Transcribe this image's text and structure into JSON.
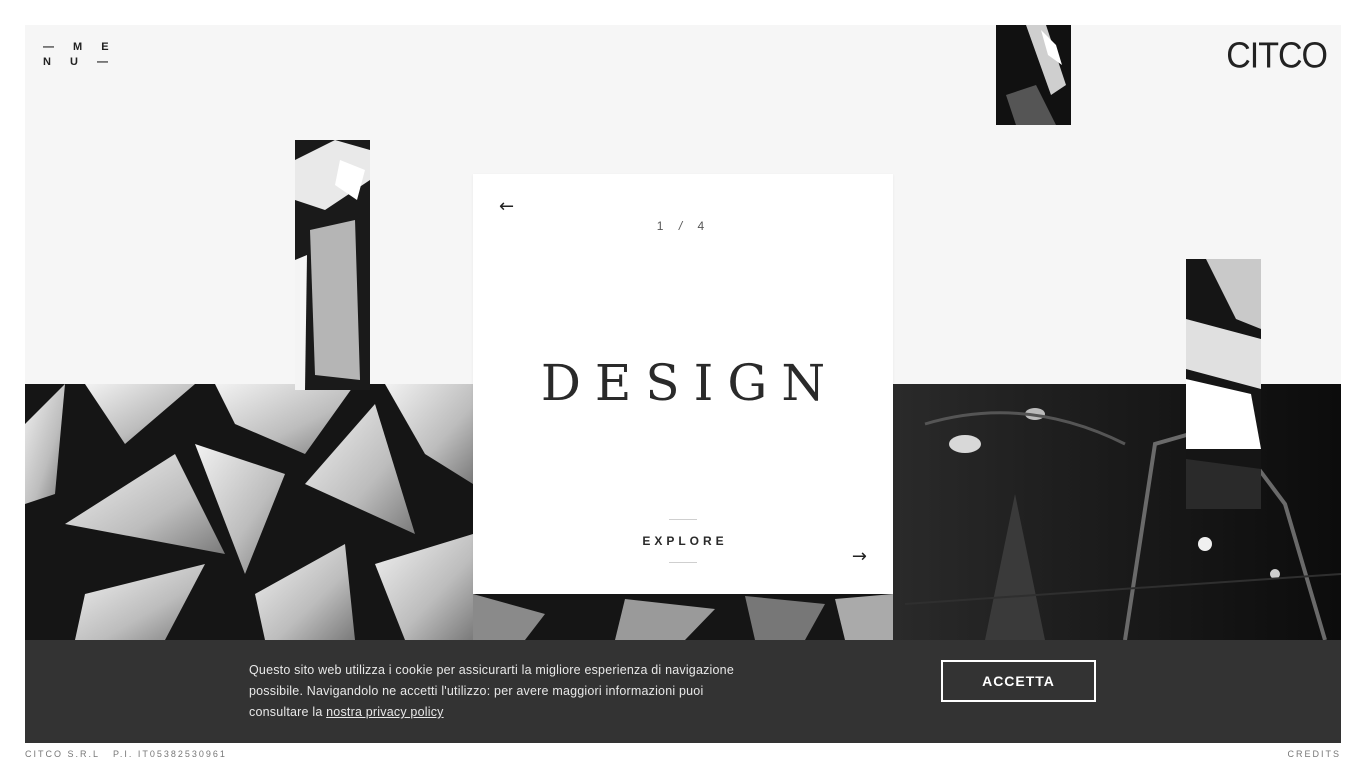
{
  "header": {
    "menu_line1": "— M E",
    "menu_line2": "N U —",
    "logo": "CITCO"
  },
  "slide": {
    "current": "1",
    "separator": "/",
    "total": "4",
    "title": "DESIGN",
    "cta": "EXPLORE",
    "prev_icon": "arrow-left-icon",
    "next_icon": "arrow-right-icon"
  },
  "cookie": {
    "text": "Questo sito web utilizza i cookie per assicurarti la migliore esperienza di navigazione possibile. Navigandolo ne accetti l'utilizzo: per avere maggiori informazioni puoi consultare la ",
    "link": "nostra privacy policy",
    "accept": "ACCETTA"
  },
  "footer": {
    "company": "CITCO S.R.L",
    "vat": "P.I. IT05382530961",
    "credits": "CREDITS"
  },
  "colors": {
    "frame_bg": "#f6f6f6",
    "cookie_bg": "#333333",
    "text_dark": "#222222"
  }
}
